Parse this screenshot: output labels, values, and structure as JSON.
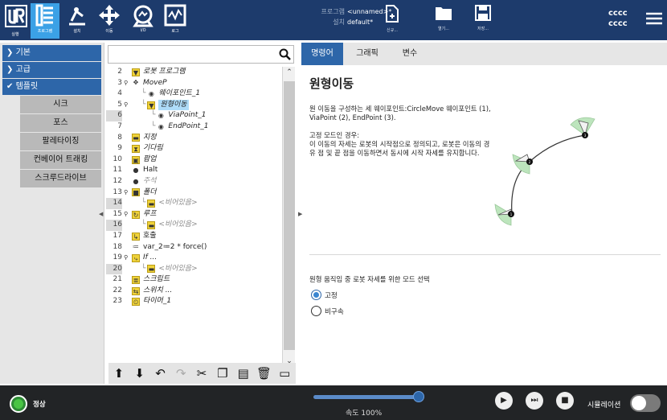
{
  "topbar": {
    "nav": [
      {
        "label": "실행",
        "icon": "run-icon"
      },
      {
        "label": "프로그램",
        "icon": "program-icon"
      },
      {
        "label": "설치",
        "icon": "installation-icon"
      },
      {
        "label": "이동",
        "icon": "move-icon"
      },
      {
        "label": "I/O",
        "icon": "io-icon"
      },
      {
        "label": "로그",
        "icon": "log-icon"
      }
    ],
    "program_key": "프로그램",
    "program_value": "<unnamed>*",
    "install_key": "설치",
    "install_value": "default*",
    "file_buttons": [
      {
        "label": "신규...",
        "icon": "new-file-icon"
      },
      {
        "label": "열기...",
        "icon": "open-folder-icon"
      },
      {
        "label": "저장...",
        "icon": "save-icon"
      }
    ],
    "user_line1": "cccc",
    "user_line2": "cccc",
    "brand_color": "#1d3b6c",
    "active_color": "#3ba1e6"
  },
  "left_tree": {
    "categories": [
      {
        "label": "기본",
        "expanded": false
      },
      {
        "label": "고급",
        "expanded": false
      },
      {
        "label": "템플릿",
        "expanded": true
      }
    ],
    "template_items": [
      "시크",
      "포스",
      "팔레타이징",
      "컨베이어 트래킹",
      "스크루드라이브"
    ]
  },
  "program": {
    "search_placeholder": "",
    "lines": [
      {
        "num": "2",
        "icon": "yellow-arrow-icon",
        "glyph": "▼",
        "yellow": true,
        "text": "로봇 프로그램",
        "italic": true,
        "indent": 0,
        "arrow": ""
      },
      {
        "num": "3",
        "icon": "move-icon",
        "glyph": "✥",
        "yellow": false,
        "text": "MoveP",
        "italic": true,
        "indent": 0,
        "arrow": "⚲"
      },
      {
        "num": "4",
        "icon": "waypoint-icon",
        "glyph": "◉",
        "yellow": false,
        "text": "웨이포인트_1",
        "italic": true,
        "indent": 1,
        "arrow": ""
      },
      {
        "num": "5",
        "icon": "yellow-arrow-icon",
        "glyph": "▼",
        "yellow": true,
        "text": "원형이동",
        "italic": true,
        "indent": 1,
        "arrow": "⚲",
        "selected": true
      },
      {
        "num": "6",
        "icon": "waypoint-icon",
        "glyph": "◉",
        "yellow": false,
        "text": "ViaPoint_1",
        "italic": true,
        "indent": 2,
        "arrow": "",
        "alt": true
      },
      {
        "num": "7",
        "icon": "waypoint-icon",
        "glyph": "◉",
        "yellow": false,
        "text": "EndPoint_1",
        "italic": true,
        "indent": 2,
        "arrow": ""
      },
      {
        "num": "8",
        "icon": "set-icon",
        "glyph": "▬",
        "yellow": true,
        "text": "지정",
        "italic": true,
        "indent": 0,
        "arrow": ""
      },
      {
        "num": "9",
        "icon": "wait-icon",
        "glyph": "⧗",
        "yellow": true,
        "text": "기다림",
        "italic": true,
        "indent": 0,
        "arrow": ""
      },
      {
        "num": "10",
        "icon": "popup-icon",
        "glyph": "▣",
        "yellow": true,
        "text": "팝업",
        "italic": true,
        "indent": 0,
        "arrow": ""
      },
      {
        "num": "11",
        "icon": "halt-icon",
        "glyph": "●",
        "yellow": false,
        "text": "Halt",
        "italic": false,
        "indent": 0,
        "arrow": ""
      },
      {
        "num": "12",
        "icon": "comment-icon",
        "glyph": "●",
        "yellow": false,
        "text": "주석",
        "italic": true,
        "indent": 0,
        "arrow": "",
        "dim": true
      },
      {
        "num": "13",
        "icon": "folder-icon",
        "glyph": "■",
        "yellow": true,
        "text": "폴더",
        "italic": true,
        "indent": 0,
        "arrow": "⚲"
      },
      {
        "num": "14",
        "icon": "empty-icon",
        "glyph": "▬",
        "yellow": true,
        "text": "<비어있음>",
        "italic": true,
        "indent": 1,
        "arrow": "",
        "dim": true,
        "alt": true
      },
      {
        "num": "15",
        "icon": "loop-icon",
        "glyph": "↻",
        "yellow": true,
        "text": "루프",
        "italic": true,
        "indent": 0,
        "arrow": "⚲"
      },
      {
        "num": "16",
        "icon": "empty-icon",
        "glyph": "▬",
        "yellow": true,
        "text": "<비어있음>",
        "italic": true,
        "indent": 1,
        "arrow": "",
        "dim": true,
        "alt": true
      },
      {
        "num": "17",
        "icon": "call-icon",
        "glyph": "↳",
        "yellow": true,
        "text": "호출",
        "italic": false,
        "indent": 0,
        "arrow": ""
      },
      {
        "num": "18",
        "icon": "assignment-icon",
        "glyph": "≔",
        "yellow": false,
        "text": "var_2≔2 * force()",
        "italic": false,
        "indent": 0,
        "arrow": ""
      },
      {
        "num": "19",
        "icon": "if-icon",
        "glyph": "⤷",
        "yellow": true,
        "text": "If ...",
        "italic": true,
        "indent": 0,
        "arrow": "⚲"
      },
      {
        "num": "20",
        "icon": "empty-icon",
        "glyph": "▬",
        "yellow": true,
        "text": "<비어있음>",
        "italic": true,
        "indent": 1,
        "arrow": "",
        "dim": true,
        "alt": true
      },
      {
        "num": "21",
        "icon": "script-icon",
        "glyph": "≣",
        "yellow": true,
        "text": "스크립트",
        "italic": true,
        "indent": 0,
        "arrow": ""
      },
      {
        "num": "22",
        "icon": "switch-icon",
        "glyph": "⇆",
        "yellow": true,
        "text": "스위치 ...",
        "italic": true,
        "indent": 0,
        "arrow": ""
      },
      {
        "num": "23",
        "icon": "timer-icon",
        "glyph": "⏲",
        "yellow": true,
        "text": "타이머_1",
        "italic": true,
        "indent": 0,
        "arrow": ""
      }
    ],
    "toolbar": [
      {
        "glyph": "⬆",
        "icon": "move-up-icon"
      },
      {
        "glyph": "⬇",
        "icon": "move-down-icon"
      },
      {
        "glyph": "↶",
        "icon": "undo-icon"
      },
      {
        "glyph": "↷",
        "icon": "redo-icon"
      },
      {
        "glyph": "✂",
        "icon": "cut-icon"
      },
      {
        "glyph": "❐",
        "icon": "copy-icon"
      },
      {
        "glyph": "▤",
        "icon": "paste-icon"
      },
      {
        "glyph": "🗑",
        "icon": "delete-icon"
      },
      {
        "glyph": "▭",
        "icon": "suppress-icon"
      }
    ]
  },
  "content": {
    "tabs": [
      "명령어",
      "그래픽",
      "변수"
    ],
    "active_tab": 0,
    "title": "원형이동",
    "desc1": "원 이동을 구성하는 세 웨이포인트:CircleMove 웨이포인트 (1), ViaPoint (2), EndPoint (3).",
    "desc2_title": "고정 모드인 경우:",
    "desc2": "이 이동의 자세는 로봇의 시작점으로 정의되고, 로봇은 이동의 경유 점 및 끝 점을 이동하면서 동시에 시작 자세를 유지합니다.",
    "mode_label": "원형 움직임 중 로봇 자세를 위한 모드 선택",
    "radio_fixed": "고정",
    "radio_free": "비구속",
    "selected_mode": "고정",
    "diagram_points": [
      "1",
      "2",
      "3"
    ]
  },
  "bottombar": {
    "status": "정상",
    "speed_label": "속도 100%",
    "speed_fraction": 1.0,
    "sim_label": "시뮬레이션",
    "controls": [
      {
        "glyph": "▶",
        "icon": "play-icon"
      },
      {
        "glyph": "⏭",
        "icon": "step-icon"
      },
      {
        "glyph": "■",
        "icon": "stop-icon"
      }
    ]
  }
}
